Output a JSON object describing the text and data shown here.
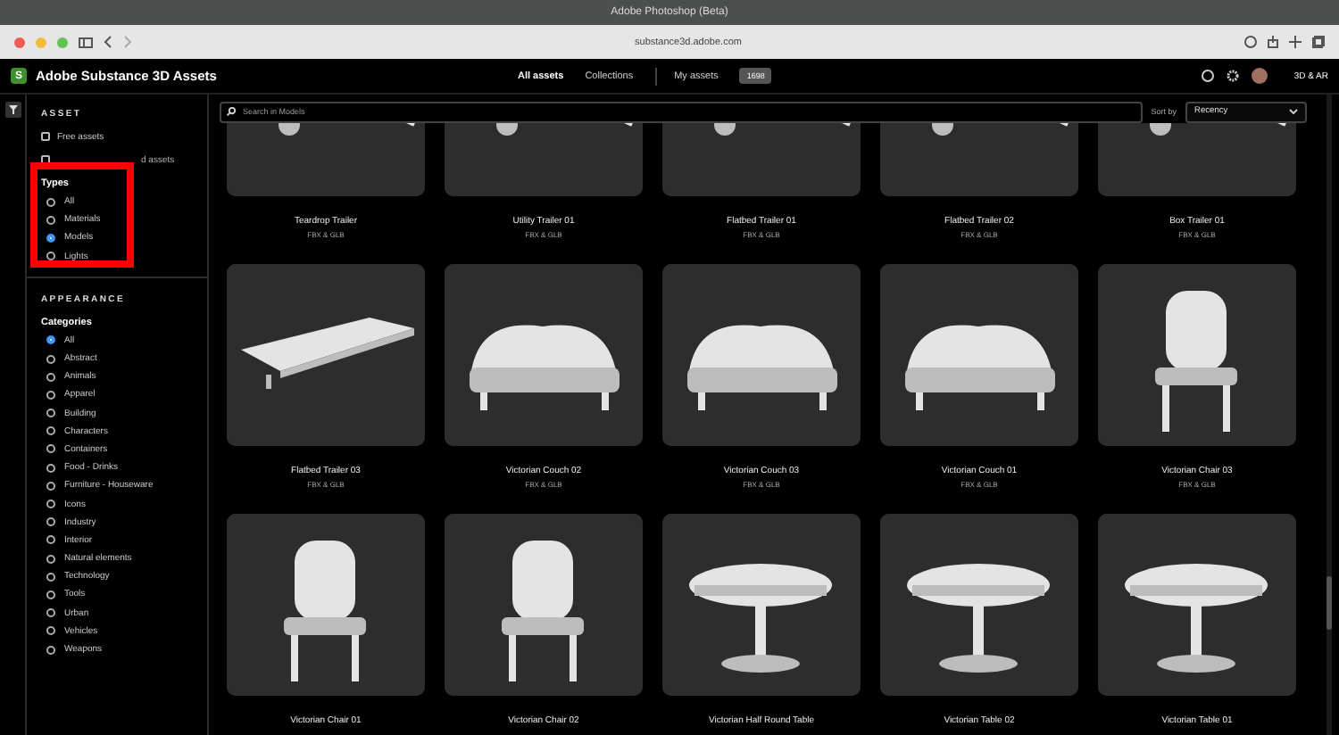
{
  "os_window": {
    "title": "Adobe Photoshop (Beta)"
  },
  "browser": {
    "url": "substance3d.adobe.com"
  },
  "header": {
    "logo": "S",
    "title": "Adobe Substance 3D Assets",
    "nav": [
      {
        "label": "All assets",
        "selected": true
      },
      {
        "label": "Collections",
        "selected": false
      }
    ],
    "my_assets": "My assets",
    "badge": "1698",
    "right_label": "3D & AR"
  },
  "sidebar": {
    "sections": [
      {
        "title": "ASSET",
        "checks": [
          {
            "label": "Free assets",
            "checked": false,
            "covered": false
          },
          {
            "label": "d assets",
            "checked": false,
            "covered": true
          }
        ],
        "groups": [
          {
            "title": "Types",
            "options": [
              {
                "label": "All",
                "selected": false
              },
              {
                "label": "Materials",
                "selected": false
              },
              {
                "label": "Models",
                "selected": true
              },
              {
                "label": "Lights",
                "selected": false
              }
            ]
          }
        ]
      },
      {
        "title": "APPEARANCE",
        "groups": [
          {
            "title": "Categories",
            "options": [
              {
                "label": "All",
                "selected": true
              },
              {
                "label": "Abstract",
                "selected": false
              },
              {
                "label": "Animals",
                "selected": false
              },
              {
                "label": "Apparel",
                "selected": false
              },
              {
                "label": "Building",
                "selected": false
              },
              {
                "label": "Characters",
                "selected": false
              },
              {
                "label": "Containers",
                "selected": false
              },
              {
                "label": "Food - Drinks",
                "selected": false
              },
              {
                "label": "Furniture - Houseware",
                "selected": false
              },
              {
                "label": "Icons",
                "selected": false
              },
              {
                "label": "Industry",
                "selected": false
              },
              {
                "label": "Interior",
                "selected": false
              },
              {
                "label": "Natural elements",
                "selected": false
              },
              {
                "label": "Technology",
                "selected": false
              },
              {
                "label": "Tools",
                "selected": false
              },
              {
                "label": "Urban",
                "selected": false
              },
              {
                "label": "Vehicles",
                "selected": false
              },
              {
                "label": "Weapons",
                "selected": false
              }
            ]
          }
        ]
      }
    ]
  },
  "highlight": {
    "kind": "frame"
  },
  "search": {
    "placeholder": "Search in Models"
  },
  "sort": {
    "label": "Sort by",
    "value": "Recency"
  },
  "assets": [
    {
      "name": "Teardrop Trailer",
      "format": "FBX & GLB",
      "kind": "trailer"
    },
    {
      "name": "Utility Trailer 01",
      "format": "FBX & GLB",
      "kind": "trailer"
    },
    {
      "name": "Flatbed Trailer 01",
      "format": "FBX & GLB",
      "kind": "trailer"
    },
    {
      "name": "Flatbed Trailer 02",
      "format": "FBX & GLB",
      "kind": "trailer"
    },
    {
      "name": "Box Trailer 01",
      "format": "FBX & GLB",
      "kind": "trailer"
    },
    {
      "name": "Flatbed Trailer 03",
      "format": "FBX & GLB",
      "kind": "flatbed"
    },
    {
      "name": "Victorian Couch 02",
      "format": "FBX & GLB",
      "kind": "couch"
    },
    {
      "name": "Victorian Couch 03",
      "format": "FBX & GLB",
      "kind": "couch"
    },
    {
      "name": "Victorian Couch 01",
      "format": "FBX & GLB",
      "kind": "couch"
    },
    {
      "name": "Victorian Chair 03",
      "format": "FBX & GLB",
      "kind": "chair"
    },
    {
      "name": "Victorian Chair 01",
      "kind": "chair"
    },
    {
      "name": "Victorian Chair 02",
      "kind": "chair"
    },
    {
      "name": "Victorian Half Round Table",
      "kind": "table"
    },
    {
      "name": "Victorian Table 02",
      "kind": "table"
    },
    {
      "name": "Victorian Table 01",
      "kind": "table"
    }
  ]
}
